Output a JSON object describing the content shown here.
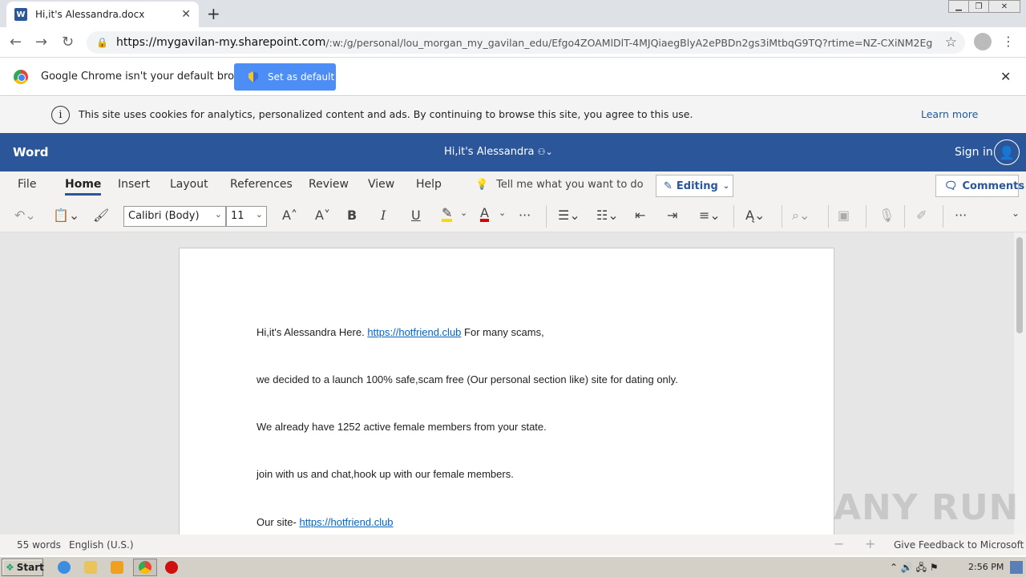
{
  "browser": {
    "tab_title": "Hi,it's Alessandra.docx",
    "tab_icon_letter": "W",
    "url_host": "https://mygavilan-my.sharepoint.com",
    "url_path": "/:w:/g/personal/lou_morgan_my_gavilan_edu/Efgo4ZOAMlDlT-4MJQiaegBlyA2ePBDn2gs3iMtbqG9TQ?rtime=NZ-CXiNM2Eg"
  },
  "infobar": {
    "message": "Google Chrome isn't your default browser",
    "button": "Set as default"
  },
  "cookie": {
    "message": "This site uses cookies for analytics, personalized content and ads. By continuing to browse this site, you agree to this use.",
    "learn_more": "Learn more"
  },
  "word": {
    "app_name": "Word",
    "doc_title": "Hi,it's Alessandra",
    "sign_in": "Sign in"
  },
  "ribbon": {
    "tabs": [
      "File",
      "Home",
      "Insert",
      "Layout",
      "References",
      "Review",
      "View",
      "Help"
    ],
    "tell_me": "Tell me what you want to do",
    "editing": "Editing",
    "comments": "Comments",
    "font": "Calibri (Body)",
    "size": "11"
  },
  "document": {
    "p1_text": "Hi,it's Alessandra Here. ",
    "p1_link": "https://hotfriend.club",
    "p1_tail": " For many scams,",
    "p2": "we decided to a launch 100% safe,scam free (Our personal section like) site for dating only.",
    "p3": "We already have 1252 active female members from your state.",
    "p4": "join with us and chat,hook up with our female members.",
    "p5_text": "Our site- ",
    "p5_link": "https://hotfriend.club"
  },
  "status": {
    "words": "55 words",
    "language": "English (U.S.)",
    "feedback": "Give Feedback to Microsoft"
  },
  "taskbar": {
    "start": "Start",
    "clock": "2:56 PM"
  },
  "watermark": "ANY RUN",
  "colors": {
    "word_blue": "#2b579a",
    "link": "#0563c1"
  }
}
